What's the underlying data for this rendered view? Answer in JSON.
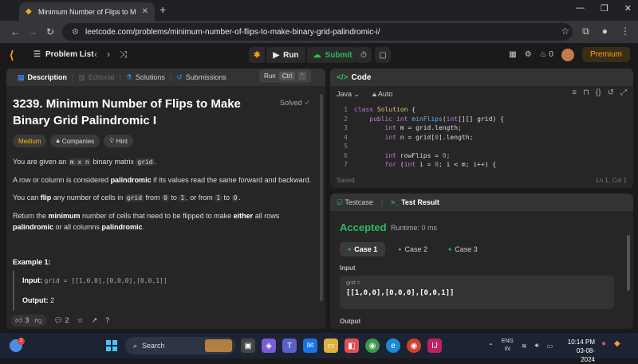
{
  "browser": {
    "tab_title": "Minimum Number of Flips to M",
    "url": "leetcode.com/problems/minimum-number-of-flips-to-make-binary-grid-palindromic-i/"
  },
  "header": {
    "problem_list": "Problem List",
    "run": "Run",
    "submit": "Submit",
    "streak": "0",
    "premium": "Premium"
  },
  "left": {
    "tabs": {
      "description": "Description",
      "editorial": "Editorial",
      "solutions": "Solutions",
      "submissions": "Submissions"
    },
    "tooltip": {
      "label": "Run",
      "key1": "Ctrl",
      "key2": "'"
    },
    "title": "3239. Minimum Number of Flips to Make Binary Grid Palindromic I",
    "solved": "Solved",
    "badges": {
      "difficulty": "Medium",
      "companies": "Companies",
      "hint": "Hint"
    },
    "p1": {
      "a": "You are given an ",
      "code1": "m x n",
      "b": " binary matrix ",
      "code2": "grid",
      "c": "."
    },
    "p2": {
      "a": "A row or column is considered ",
      "b": "palindromic",
      "c": " if its values read the same forward and backward."
    },
    "p3": {
      "a": "You can ",
      "b": "flip",
      "c": " any number of cells in ",
      "code1": "grid",
      "d": " from ",
      "code2": "0",
      "e": " to ",
      "code3": "1",
      "f": ", or from ",
      "code4": "1",
      "g": " to ",
      "code5": "0",
      "h": "."
    },
    "p4": {
      "a": "Return the ",
      "b": "minimum",
      "c": " number of cells that need to be flipped to make ",
      "d": "either",
      "e": " all rows ",
      "f": "palindromic",
      "g": " or all columns ",
      "h": "palindromic",
      "i": "."
    },
    "example_title": "Example 1:",
    "example_input_label": "Input:",
    "example_input": "grid = [[1,0,0],[0,0,0],[0,0,1]]",
    "example_output_label": "Output:",
    "example_output": "2",
    "likes": "3",
    "comments": "2"
  },
  "code": {
    "title": "Code",
    "language": "Java",
    "mode": "Auto",
    "lines": [
      {
        "n": "1",
        "t": "class Solution {"
      },
      {
        "n": "2",
        "t": "    public int minFlips(int[][] grid) {"
      },
      {
        "n": "3",
        "t": "        int m = grid.length;"
      },
      {
        "n": "4",
        "t": "        int n = grid[0].length;"
      },
      {
        "n": "5",
        "t": ""
      },
      {
        "n": "6",
        "t": "        int rowFlips = 0;"
      },
      {
        "n": "7",
        "t": "        for (int i = 0; i < m; i++) {"
      }
    ],
    "saved": "Saved",
    "position": "Ln 1, Col 1"
  },
  "result": {
    "tab_testcase": "Testcase",
    "tab_result": "Test Result",
    "status": "Accepted",
    "runtime": "Runtime: 0 ms",
    "cases": [
      "Case 1",
      "Case 2",
      "Case 3"
    ],
    "input_label": "Input",
    "var_name": "grid =",
    "var_value": "[[1,0,0],[0,0,0],[0,0,1]]",
    "output_label": "Output"
  },
  "taskbar": {
    "search": "Search",
    "lang1": "ENG",
    "lang2": "IN",
    "time": "10:14 PM",
    "date": "03-08-2024",
    "notif": "1"
  }
}
